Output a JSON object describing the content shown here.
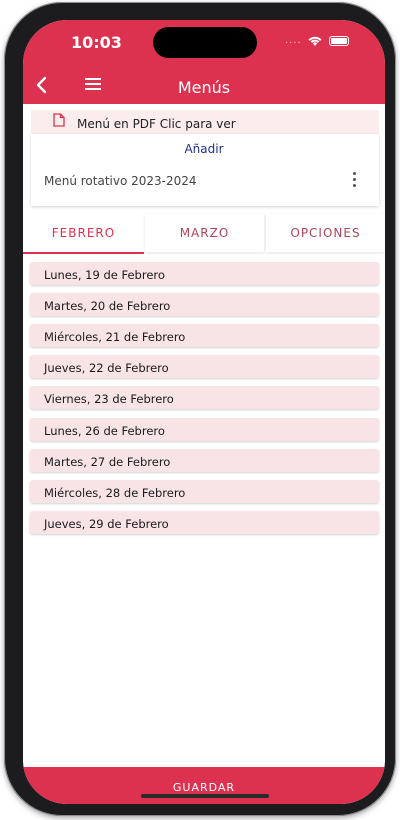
{
  "status_bar": {
    "time": "10:03",
    "dots": "...."
  },
  "nav": {
    "title": "Menús"
  },
  "pdf": {
    "label": "Menú en PDF Clic para ver"
  },
  "add_link": "Añadir",
  "menu_card": {
    "title": "Menú rotativo 2023-2024"
  },
  "tabs": [
    {
      "label": "FEBRERO",
      "active": true
    },
    {
      "label": "MARZO",
      "active": false
    },
    {
      "label": "OPCIONES",
      "active": false
    }
  ],
  "days": [
    {
      "label": "Lunes, 19 de Febrero"
    },
    {
      "label": "Martes, 20 de Febrero"
    },
    {
      "label": "Miércoles, 21 de Febrero"
    },
    {
      "label": "Jueves, 22 de Febrero"
    },
    {
      "label": "Viernes, 23 de Febrero"
    },
    {
      "label": "Lunes, 26 de Febrero"
    },
    {
      "label": "Martes, 27 de Febrero"
    },
    {
      "label": "Miércoles, 28 de Febrero"
    },
    {
      "label": "Jueves, 29 de Febrero"
    }
  ],
  "footer": {
    "save_label": "GUARDAR"
  },
  "colors": {
    "accent": "#dc3250",
    "row_bg": "#f8e3e6",
    "link": "#20328c"
  }
}
